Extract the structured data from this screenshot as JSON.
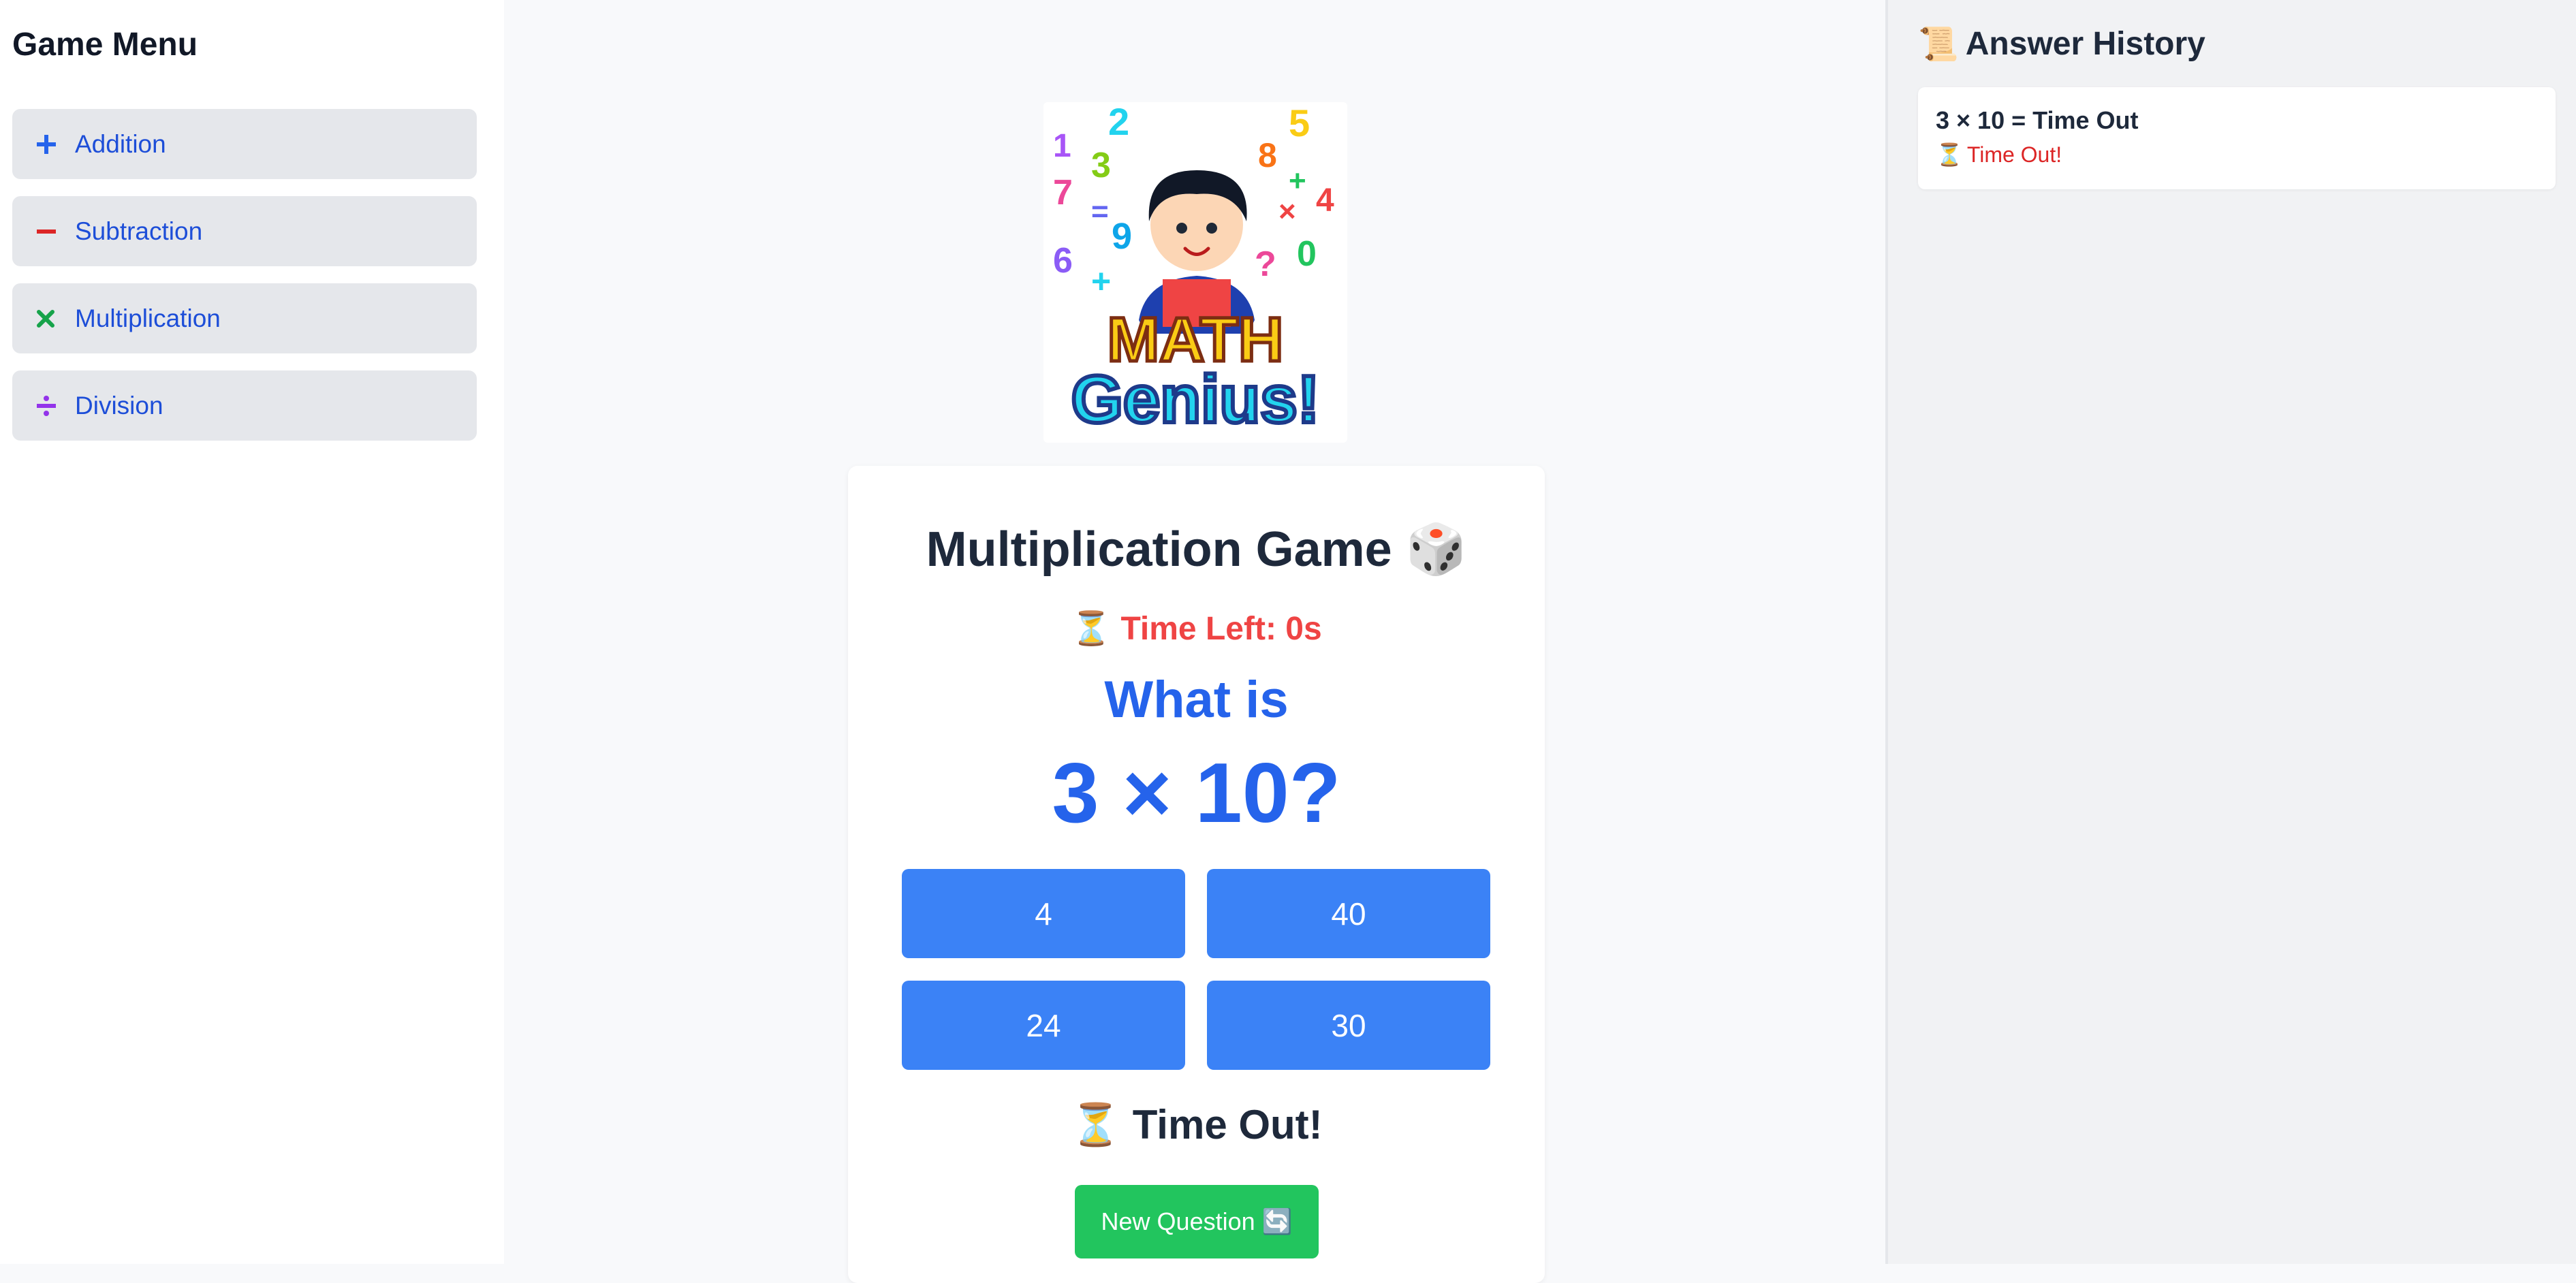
{
  "sidebar": {
    "title": "Game Menu",
    "items": [
      {
        "label": "Addition",
        "icon": "plus-icon",
        "color": "#2563eb"
      },
      {
        "label": "Subtraction",
        "icon": "minus-icon",
        "color": "#dc2626"
      },
      {
        "label": "Multiplication",
        "icon": "times-icon",
        "color": "#16a34a"
      },
      {
        "label": "Division",
        "icon": "divide-icon",
        "color": "#9333ea"
      }
    ]
  },
  "logo": {
    "line1": "MATH",
    "line2": "Genius!"
  },
  "game": {
    "title": "Multiplication Game 🎲",
    "timer": "Time Left: 0s",
    "question_prefix": "What is",
    "question": "3 × 10?",
    "answers": [
      "4",
      "40",
      "24",
      "30"
    ],
    "result": "Time Out!",
    "new_question_label": "New Question 🔄"
  },
  "history": {
    "title": "Answer History",
    "entries": [
      {
        "equation": "3 × 10 = Time Out",
        "status": "Time Out!"
      }
    ]
  },
  "colors": {
    "primary": "#3b82f6",
    "accent_green": "#22c55e",
    "timer_red": "#ef4444"
  }
}
